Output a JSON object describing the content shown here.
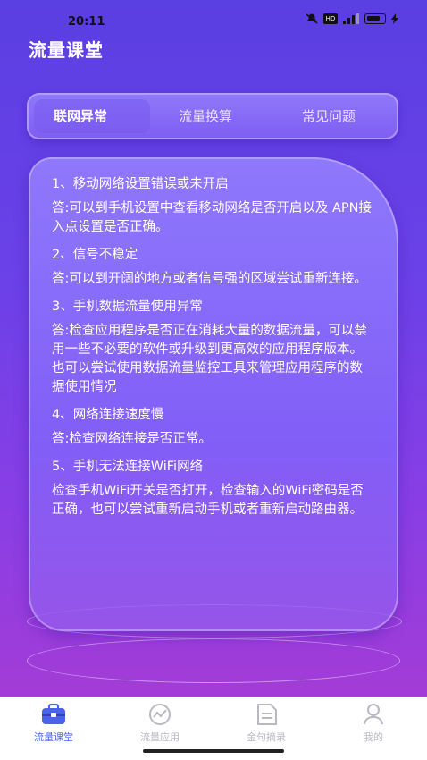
{
  "status": {
    "time": "20:11",
    "hd": "HD"
  },
  "header": {
    "title": "流量课堂"
  },
  "tabs": [
    {
      "label": "联网异常",
      "active": true
    },
    {
      "label": "流量换算",
      "active": false
    },
    {
      "label": "常见问题",
      "active": false
    }
  ],
  "faq": [
    {
      "q": "1、移动网络设置错误或未开启",
      "a": "答:可以到手机设置中查看移动网络是否开启以及 APN接入点设置是否正确。"
    },
    {
      "q": "2、信号不稳定",
      "a": "答:可以到开阔的地方或者信号强的区域尝试重新连接。"
    },
    {
      "q": "3、手机数据流量使用异常",
      "a": "答:检查应用程序是否正在消耗大量的数据流量，可以禁用一些不必要的软件或升级到更高效的应用程序版本。也可以尝试使用数据流量监控工具来管理应用程序的数据使用情况"
    },
    {
      "q": "4、网络连接速度慢",
      "a": "答:检查网络连接是否正常。"
    },
    {
      "q": "5、手机无法连接WiFi网络",
      "a": "检查手机WiFi开关是否打开，检查输入的WiFi密码是否正确，也可以尝试重新启动手机或者重新启动路由器。"
    }
  ],
  "nav": [
    {
      "label": "流量课堂",
      "icon": "toolbox-icon",
      "active": true
    },
    {
      "label": "流量应用",
      "icon": "chart-circle-icon",
      "active": false
    },
    {
      "label": "金句摘录",
      "icon": "document-icon",
      "active": false
    },
    {
      "label": "我的",
      "icon": "profile-icon",
      "active": false
    }
  ],
  "colors": {
    "accent": "#4b63e6",
    "inactive": "#b9b9c3",
    "bg_top": "#5a3fe2",
    "bg_bottom": "#a33cd6"
  }
}
